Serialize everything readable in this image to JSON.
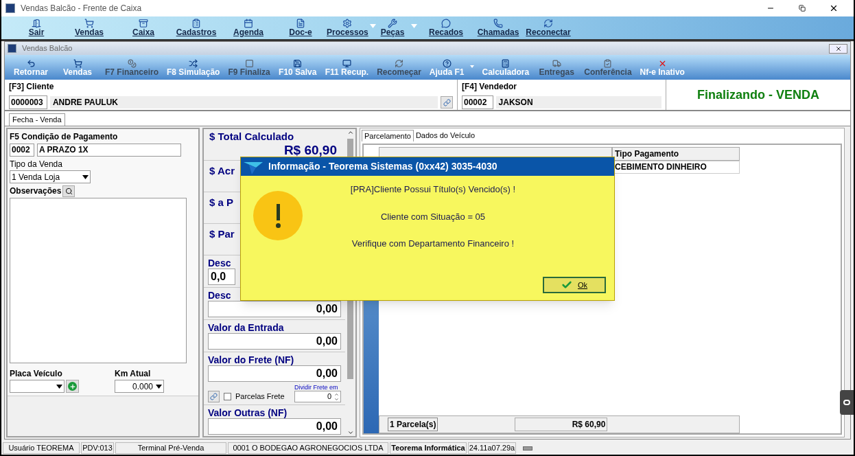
{
  "window": {
    "title": "Vendas Balcão - Frente de Caixa"
  },
  "main_toolbar": [
    {
      "label": "Sair",
      "menu_arrow": false
    },
    {
      "label": "Vendas",
      "menu_arrow": false
    },
    {
      "label": "Caixa",
      "menu_arrow": false
    },
    {
      "label": "Cadastros",
      "menu_arrow": false
    },
    {
      "label": "Agenda",
      "menu_arrow": false
    },
    {
      "label": "Doc-e",
      "menu_arrow": false
    },
    {
      "label": "Processos",
      "menu_arrow": true
    },
    {
      "label": "Peças",
      "menu_arrow": true
    },
    {
      "label": "Recados",
      "menu_arrow": false
    },
    {
      "label": "Chamadas",
      "menu_arrow": false
    },
    {
      "label": "Reconectar",
      "menu_arrow": false
    }
  ],
  "inner_window": {
    "title": "Vendas Balcão"
  },
  "toolbar": [
    {
      "label": "Retornar",
      "disabled": false,
      "menu_arrow": false
    },
    {
      "label": "Vendas",
      "disabled": false,
      "menu_arrow": false
    },
    {
      "label": "F7 Financeiro",
      "disabled": true,
      "menu_arrow": false
    },
    {
      "label": "F8 Simulação",
      "disabled": false,
      "menu_arrow": false
    },
    {
      "label": "F9 Finaliza",
      "disabled": true,
      "menu_arrow": false
    },
    {
      "label": "F10 Salva",
      "disabled": false,
      "menu_arrow": false
    },
    {
      "label": "F11 Recup.",
      "disabled": false,
      "menu_arrow": false
    },
    {
      "label": "Recomeçar",
      "disabled": true,
      "menu_arrow": false
    },
    {
      "label": "Ajuda F1",
      "disabled": false,
      "menu_arrow": true
    },
    {
      "label": "Calculadora",
      "disabled": false,
      "menu_arrow": false
    },
    {
      "label": "Entregas",
      "disabled": true,
      "menu_arrow": false
    },
    {
      "label": "Conferência",
      "disabled": true,
      "menu_arrow": false
    },
    {
      "label": "Nf-e Inativo",
      "disabled": false,
      "menu_arrow": false
    }
  ],
  "cliente": {
    "label": "[F3] Cliente",
    "code": "0000003",
    "name": "ANDRE PAULUK"
  },
  "vendedor": {
    "label": "[F4] Vendedor",
    "code": "00002",
    "name": "JAKSON"
  },
  "status_banner": "Finalizando - VENDA",
  "tabs": [
    {
      "label": "Fecha - Venda",
      "selected": true
    }
  ],
  "pagamento": {
    "label": "F5 Condição de Pagamento",
    "code": "0002",
    "name": "A PRAZO 1X",
    "tipo_label": "Tipo da Venda",
    "tipo_value": "1 Venda Loja",
    "obs_label": "Observações",
    "placa_label": "Placa Veículo",
    "km_label": "Km Atual",
    "km_value": "0.000"
  },
  "totals": [
    {
      "kind": "total",
      "label": "$ Total Calculado",
      "value": "R$ 60,90"
    },
    {
      "kind": "heading",
      "label": "$ Acr"
    },
    {
      "kind": "heading",
      "label": "$ a P"
    },
    {
      "kind": "heading",
      "label": "$ Par"
    },
    {
      "kind": "short_field",
      "label": "Desc",
      "value": "0,0"
    },
    {
      "kind": "field",
      "label": "Desc",
      "value": "0,00"
    },
    {
      "kind": "field",
      "label": "Valor da Entrada",
      "value": "0,00"
    },
    {
      "kind": "field",
      "label": "Valor do Frete (NF)",
      "value": "0,00",
      "options": {
        "label": "Parcelas Frete",
        "checked": false,
        "split_label": "Dividir Frete em",
        "split_value": "0"
      }
    },
    {
      "kind": "field",
      "label": "Valor Outras (NF)",
      "value": "0,00"
    }
  ],
  "right_tabs": [
    {
      "label": "Parcelamento",
      "selected": true
    },
    {
      "label": "Dados do Veículo",
      "selected": false
    }
  ],
  "table": {
    "columns": [
      "Tipo Pagamento"
    ],
    "rows": [
      [
        "CEBIMENTO DINHEIRO"
      ]
    ]
  },
  "footer": {
    "count": "1 Parcela(s)",
    "total": "R$ 60,90"
  },
  "dialog": {
    "title": "Informação - Teorema Sistemas (0xx42) 3035-4030",
    "lines": [
      "[PRA]Cliente Possui Título(s) Vencido(s) !",
      "Cliente com Situação = 05",
      "Verifique com Departamento Financeiro !"
    ],
    "ok": "Ok"
  },
  "status_bar": [
    {
      "text": "Usuário TEOREMA",
      "bold": false
    },
    {
      "text": "PDV:013",
      "bold": false
    },
    {
      "text": "Terminal Pré-Venda",
      "bold": false
    },
    {
      "text": "0001 O BODEGAO AGRONEGOCIOS LTDA",
      "bold": false
    },
    {
      "text": "Teorema Informática",
      "bold": true
    },
    {
      "text": "24.11a07.29a",
      "bold": false
    }
  ]
}
